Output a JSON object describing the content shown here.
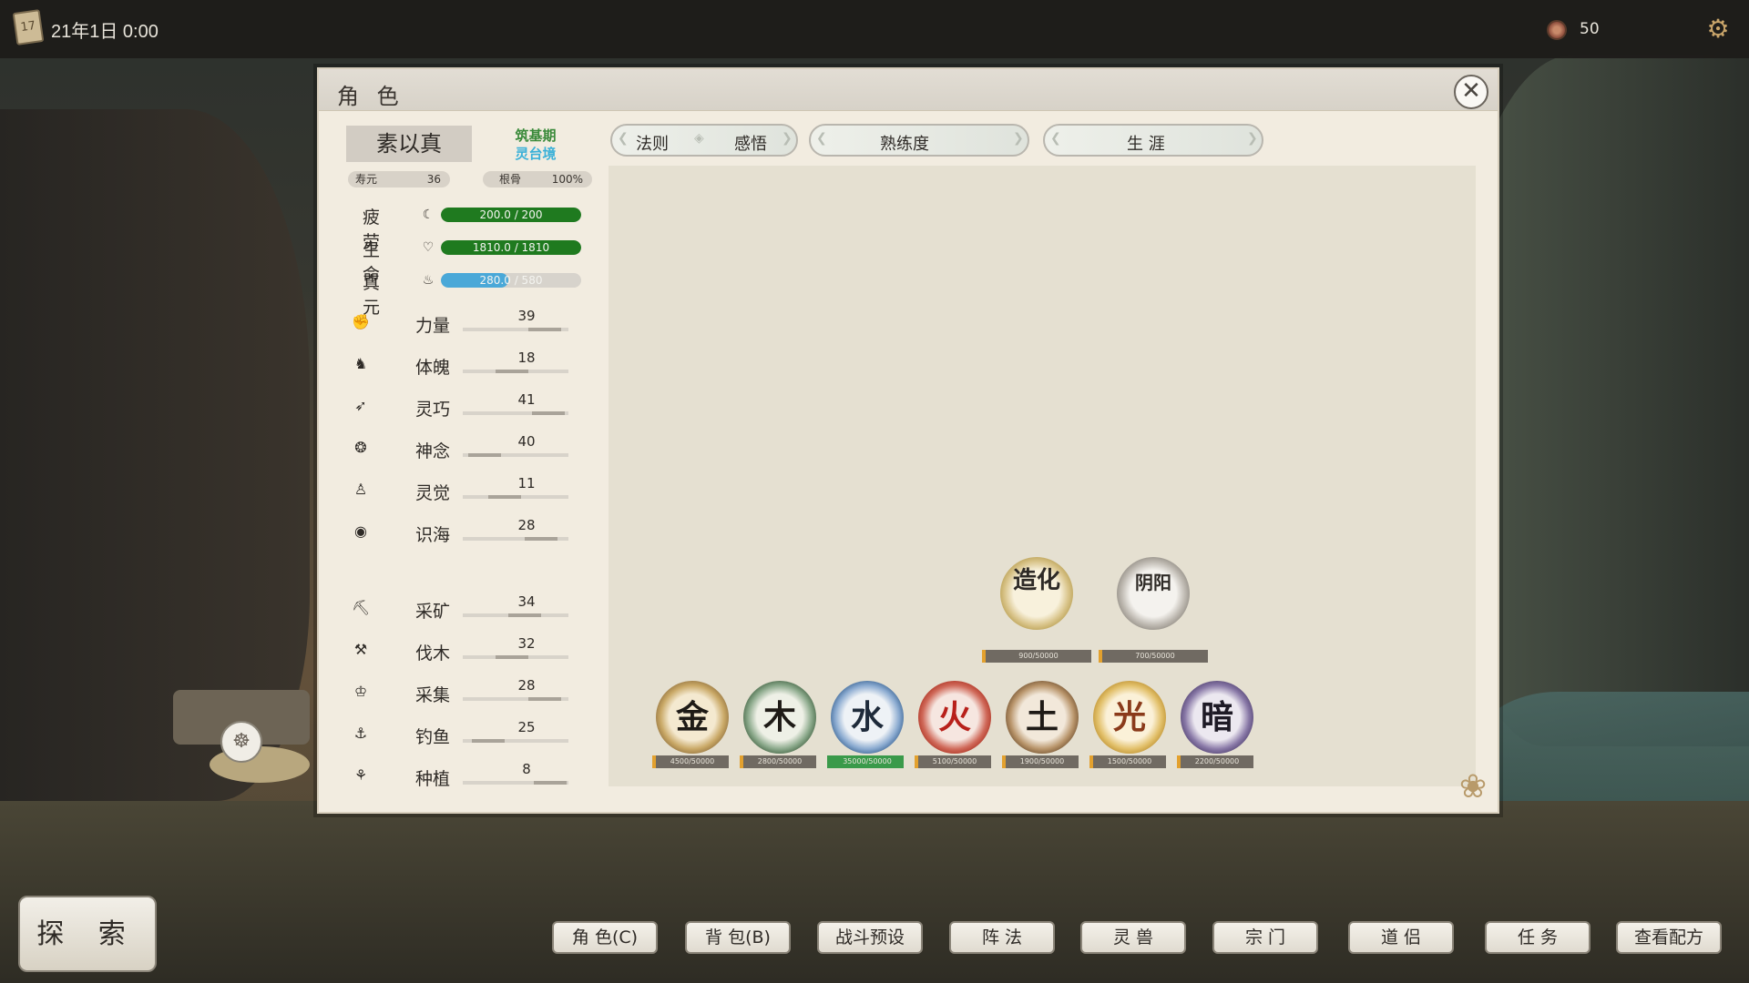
{
  "topbar": {
    "calendar_icon": "calendar-scroll-icon",
    "date": "21年1日  0:00",
    "currency_icon": "coin-icon",
    "currency": "50",
    "settings_icon": "gear-icon"
  },
  "panel": {
    "title": "角 色",
    "close_label": "✕"
  },
  "character": {
    "name": "素以真",
    "realm": "筑基期",
    "sub_realm": "灵台境",
    "lifespan_label": "寿元",
    "lifespan": "36",
    "root_label": "根骨",
    "root": "100%"
  },
  "vitals": [
    {
      "label": "疲劳",
      "text": "200.0 / 200",
      "current": 200,
      "max": 200,
      "color": "#1f7a1f"
    },
    {
      "label": "生命",
      "text": "1810.0 / 1810",
      "current": 1810,
      "max": 1810,
      "color": "#1f7a1f"
    },
    {
      "label": "真元",
      "text": "280.0 / 580",
      "current": 280,
      "max": 580,
      "color": "#4aa8d8"
    }
  ],
  "attributes": [
    {
      "label": "力量",
      "value": "39"
    },
    {
      "label": "体魄",
      "value": "18"
    },
    {
      "label": "灵巧",
      "value": "41"
    },
    {
      "label": "神念",
      "value": "40"
    },
    {
      "label": "灵觉",
      "value": "11"
    },
    {
      "label": "识海",
      "value": "28"
    }
  ],
  "skills": [
    {
      "label": "采矿",
      "value": "34"
    },
    {
      "label": "伐木",
      "value": "32"
    },
    {
      "label": "采集",
      "value": "28"
    },
    {
      "label": "钓鱼",
      "value": "25"
    },
    {
      "label": "种植",
      "value": "8"
    }
  ],
  "tabs": [
    {
      "label_a": "法则",
      "label_b": "感悟"
    },
    {
      "label": "熟练度"
    },
    {
      "label": "生  涯"
    }
  ],
  "laws_upper": [
    {
      "char": "造化",
      "text": "900/50000",
      "progress": 0.018
    },
    {
      "char": "阴阳",
      "text": "700/50000",
      "progress": 0.014
    }
  ],
  "elements": [
    {
      "char": "金",
      "text": "4500/50000",
      "progress": 0.09,
      "color": "#6a5a3a"
    },
    {
      "char": "木",
      "text": "2800/50000",
      "progress": 0.056,
      "color": "#3a5a3a"
    },
    {
      "char": "水",
      "text": "35000/50000",
      "progress": 0.7,
      "color": "#2f5a8a"
    },
    {
      "char": "火",
      "text": "5100/50000",
      "progress": 0.102,
      "color": "#a82a1a"
    },
    {
      "char": "土",
      "text": "1900/50000",
      "progress": 0.038,
      "color": "#6a4a2a"
    },
    {
      "char": "光",
      "text": "1500/50000",
      "progress": 0.03,
      "color": "#b88a2a"
    },
    {
      "char": "暗",
      "text": "2200/50000",
      "progress": 0.044,
      "color": "#4a3a6a"
    }
  ],
  "bottom": {
    "explore": "探 索",
    "nav": [
      "角 色(C)",
      "背 包(B)",
      "战斗预设",
      "阵   法",
      "灵   兽",
      "宗   门",
      "道   侣",
      "任   务",
      "查看配方"
    ]
  }
}
